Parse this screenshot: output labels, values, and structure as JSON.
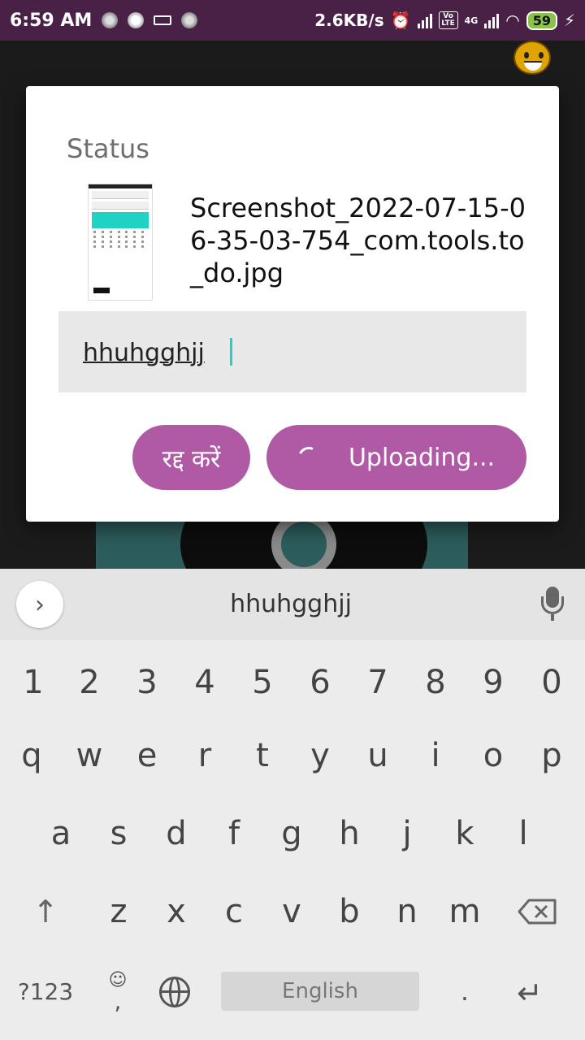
{
  "status_bar": {
    "time": "6:59 AM",
    "net_speed": "2.6KB/s",
    "battery": "59",
    "volte": "Vo LTE",
    "network": "4G"
  },
  "dialog": {
    "title": "Status",
    "filename": "Screenshot_2022-07-15-06-35-03-754_com.tools.to_do.jpg",
    "input_value": "hhuhgghjj",
    "cancel_label": "रद्द करें",
    "upload_label": "Uploading..."
  },
  "keyboard": {
    "suggestion": "hhuhgghjj",
    "number_row": [
      "1",
      "2",
      "3",
      "4",
      "5",
      "6",
      "7",
      "8",
      "9",
      "0"
    ],
    "row1": [
      "q",
      "w",
      "e",
      "r",
      "t",
      "y",
      "u",
      "i",
      "o",
      "p"
    ],
    "row2": [
      "a",
      "s",
      "d",
      "f",
      "g",
      "h",
      "j",
      "k",
      "l"
    ],
    "row3": [
      "z",
      "x",
      "c",
      "v",
      "b",
      "n",
      "m"
    ],
    "symbols_label": "?123",
    "emoji_comma": ",",
    "space_label": "English",
    "period": "."
  },
  "icons": {
    "expand": "chevron-right-icon",
    "mic": "microphone-icon",
    "shift": "shift-arrow-icon",
    "backspace": "backspace-icon",
    "globe": "globe-icon",
    "enter": "enter-icon"
  },
  "colors": {
    "status_bar": "#4a2146",
    "button": "#b05aa6",
    "caret": "#1ed3c4"
  }
}
